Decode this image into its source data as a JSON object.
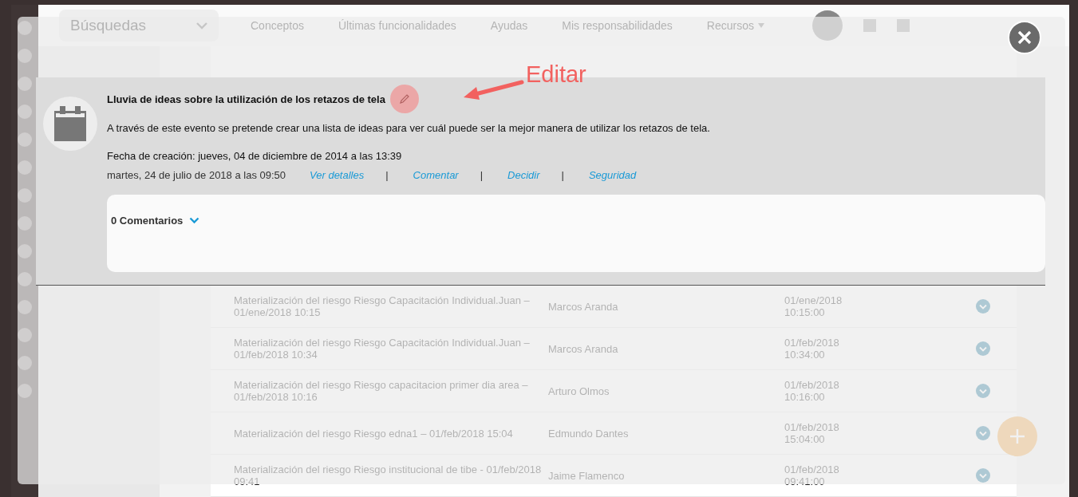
{
  "app": {
    "search_dropdown": "Búsquedas",
    "nav": [
      "Conceptos",
      "Últimas funcionalidades",
      "Ayudas",
      "Mis responsabilidades",
      "Recursos"
    ],
    "rows": [
      {
        "title": "Materialización del riesgo Riesgo Capacitación Individual.Juan – 01/ene/2018 10:15",
        "person": "Marcos Aranda",
        "date": "01/ene/2018",
        "time": "10:15:00"
      },
      {
        "title": "Materialización del riesgo Riesgo Capacitación Individual.Juan – 01/feb/2018 10:34",
        "person": "Marcos Aranda",
        "date": "01/feb/2018",
        "time": "10:34:00"
      },
      {
        "title": "Materialización del riesgo Riesgo capacitacion primer dia area – 01/feb/2018 10:16",
        "person": "Arturo Olmos",
        "date": "01/feb/2018",
        "time": "10:16:00"
      },
      {
        "title": "Materialización del riesgo Riesgo edna1 – 01/feb/2018 15:04",
        "person": "Edmundo Dantes",
        "date": "01/feb/2018",
        "time": "15:04:00"
      },
      {
        "title": "Materialización del riesgo Riesgo institucional de tibe - 01/feb/2018 09:41",
        "person": "Jaime Flamenco",
        "date": "01/feb/2018",
        "time": "09:41:00"
      }
    ]
  },
  "modal": {
    "event": {
      "title": "Lluvia de ideas sobre la utilización de los retazos de tela",
      "description": "A través de este evento se pretende crear una lista de ideas para ver cuál puede ser la mejor manera de utilizar los retazos de tela.",
      "created": "Fecha de creación: jueves, 04 de diciembre de 2014 a las 13:39",
      "date": "martes, 24 de julio de 2018 a las 09:50",
      "actions": [
        "Ver detalles",
        "Comentar",
        "Decidir",
        "Seguridad"
      ],
      "separators": [
        "|",
        "|",
        "|"
      ]
    },
    "comments": {
      "label": "0 Comentarios",
      "expanded": false
    }
  },
  "annotation": {
    "label": "Editar"
  }
}
